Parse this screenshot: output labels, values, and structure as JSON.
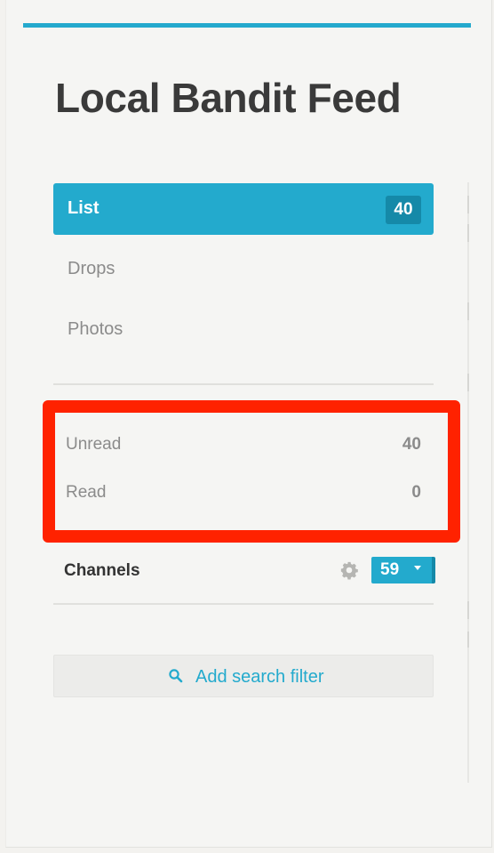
{
  "header": {
    "title": "Local Bandit Feed"
  },
  "nav": {
    "items": [
      {
        "label": "List",
        "count": "40",
        "active": true
      },
      {
        "label": "Drops"
      },
      {
        "label": "Photos"
      }
    ]
  },
  "filters": {
    "items": [
      {
        "label": "Unread",
        "count": "40"
      },
      {
        "label": "Read",
        "count": "0"
      }
    ]
  },
  "channels": {
    "label": "Channels",
    "count": "59",
    "settings_icon": "gear-icon",
    "dropdown_icon": "caret-down-icon"
  },
  "search_filter": {
    "label": "Add search filter",
    "icon": "search-icon"
  },
  "colors": {
    "accent": "#23aacd",
    "accent_dark": "#1589a8",
    "highlight": "#ff2200",
    "text_muted": "#8b8b8b",
    "text_dark": "#333333"
  }
}
